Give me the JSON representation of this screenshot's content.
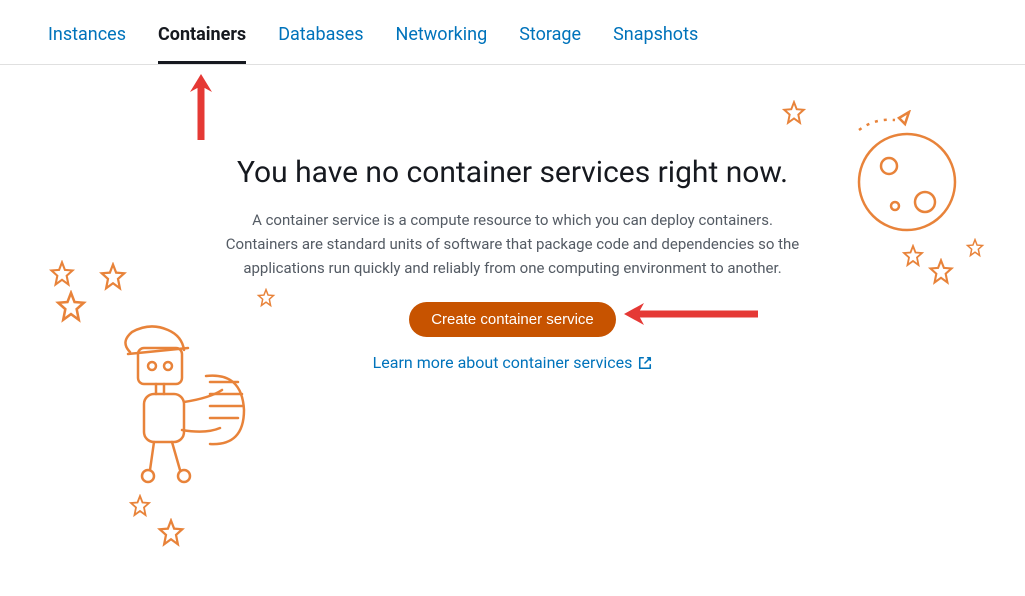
{
  "tabs": [
    {
      "label": "Instances"
    },
    {
      "label": "Containers"
    },
    {
      "label": "Databases"
    },
    {
      "label": "Networking"
    },
    {
      "label": "Storage"
    },
    {
      "label": "Snapshots"
    }
  ],
  "activeTabIndex": 1,
  "empty_state": {
    "heading": "You have no container services right now.",
    "description": "A container service is a compute resource to which you can deploy containers. Containers are standard units of software that package code and dependencies so the applications run quickly and reliably from one computing environment to another.",
    "button_label": "Create container service",
    "learn_more_label": "Learn more about container services"
  }
}
